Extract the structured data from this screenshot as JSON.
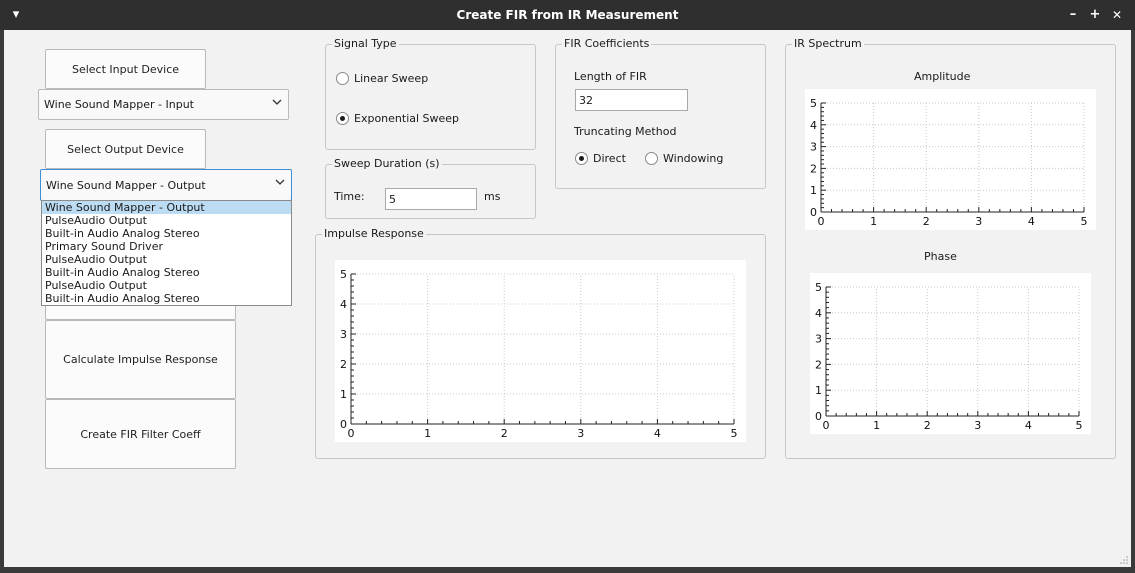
{
  "window": {
    "title": "Create FIR from IR Measurement",
    "menu_glyph": "▾",
    "controls": {
      "minimize": "–",
      "maximize": "+",
      "close": "✕"
    }
  },
  "left_panel": {
    "select_input_label": "Select Input Device",
    "input_combo_value": "Wine Sound Mapper - Input",
    "select_output_label": "Select Output Device",
    "output_combo_value": "Wine Sound Mapper - Output",
    "output_options": [
      "Wine Sound Mapper - Output",
      "PulseAudio Output",
      "Built-in Audio Analog Stereo",
      "Primary Sound Driver",
      "PulseAudio Output",
      "Built-in Audio Analog Stereo",
      "PulseAudio Output",
      "Built-in Audio Analog Stereo"
    ],
    "calc_ir_label": "Calculate Impulse Response",
    "create_fir_label": "Create FIR Filter Coeff"
  },
  "signal_type": {
    "title": "Signal Type",
    "linear": "Linear Sweep",
    "exponential": "Exponential Sweep",
    "selected": "exponential"
  },
  "sweep": {
    "title": "Sweep Duration (s)",
    "time_label": "Time:",
    "time_value": "5",
    "unit": "ms"
  },
  "fir": {
    "title": "FIR Coefficients",
    "length_label": "Length of FIR",
    "length_value": "32",
    "truncating_label": "Truncating Method",
    "direct": "Direct",
    "windowing": "Windowing",
    "selected": "direct"
  },
  "impulse_response": {
    "title": "Impulse Response"
  },
  "ir_spectrum": {
    "title": "IR Spectrum",
    "amplitude": "Amplitude",
    "phase": "Phase"
  },
  "chart_data": [
    {
      "type": "line",
      "name_label": "Impulse Response",
      "series": [],
      "xlim": [
        0,
        5
      ],
      "ylim": [
        0,
        5
      ],
      "xticks": [
        "0",
        "1",
        "2",
        "3",
        "4",
        "5"
      ],
      "yticks": [
        "0",
        "1",
        "2",
        "3",
        "4",
        "5"
      ],
      "grid": true
    },
    {
      "type": "line",
      "title": "Amplitude",
      "series": [],
      "xlim": [
        0,
        5
      ],
      "ylim": [
        0,
        5
      ],
      "xticks": [
        "0",
        "1",
        "2",
        "3",
        "4",
        "5"
      ],
      "yticks": [
        "0",
        "1",
        "2",
        "3",
        "4",
        "5"
      ],
      "grid": true
    },
    {
      "type": "line",
      "title": "Phase",
      "series": [],
      "xlim": [
        0,
        5
      ],
      "ylim": [
        0,
        5
      ],
      "xticks": [
        "0",
        "1",
        "2",
        "3",
        "4",
        "5"
      ],
      "yticks": [
        "0",
        "1",
        "2",
        "3",
        "4",
        "5"
      ],
      "grid": true
    }
  ]
}
